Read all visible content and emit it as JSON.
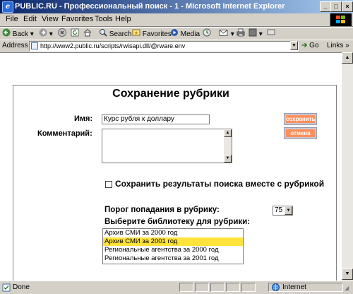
{
  "window": {
    "title": "PUBLIC.RU - Профессиональный поиск - 1 - Microsoft Internet Explorer",
    "minimize": "_",
    "maximize": "□",
    "close": "×"
  },
  "menu": [
    "File",
    "Edit",
    "View",
    "Favorites",
    "Tools",
    "Help"
  ],
  "toolbar": {
    "back": "Back",
    "search": "Search",
    "favorites": "Favorites",
    "media": "Media"
  },
  "address": {
    "label": "Address",
    "url": "http://www2.public.ru/scripts/rwisapi.dll/@rware.env",
    "go": "Go",
    "links": "Links"
  },
  "form": {
    "title": "Сохранение рубрики",
    "name_label": "Имя:",
    "name_value": "Курс рубля к доллару",
    "comment_label": "Комментарий:",
    "save_button": "сохранить",
    "cancel_button": "отмена",
    "checkbox_label": "Сохранить результаты поиска вместе с рубрикой",
    "checkbox_checked": false,
    "threshold_label": "Порог попадания в рубрику:",
    "threshold_value": "75",
    "library_label": "Выберите библиотеку для рубрики:",
    "libraries": [
      {
        "label": "Архив СМИ за 2000 год",
        "selected": false
      },
      {
        "label": "Архив СМИ за 2001 год",
        "selected": true
      },
      {
        "label": "Региональные агентства за 2000 год",
        "selected": false
      },
      {
        "label": "Региональные агентства за 2001 год",
        "selected": false
      }
    ]
  },
  "status": {
    "left": "Done",
    "zone": "Internet"
  },
  "colors": {
    "titlebar_start": "#0a246a",
    "titlebar_end": "#a6caf0",
    "button_orange": "#ff8f5a",
    "selection_yellow": "#ffe23a"
  }
}
